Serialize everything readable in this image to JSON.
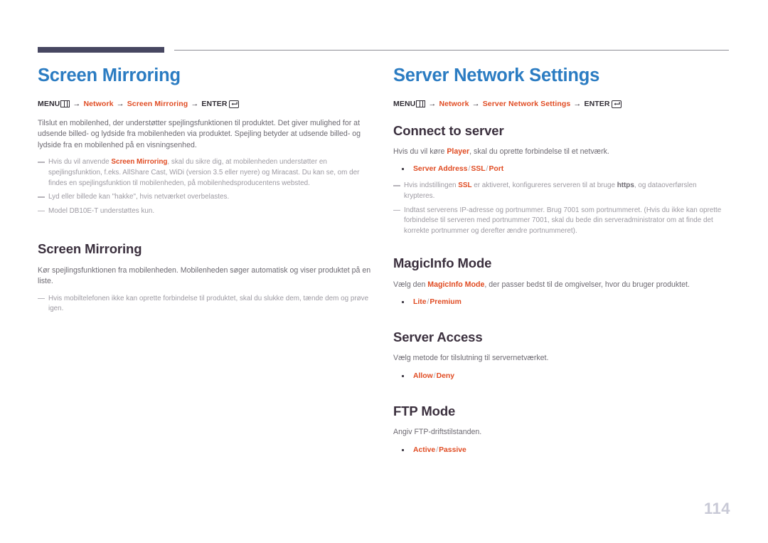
{
  "page": {
    "number": "114",
    "accent_blue": "#2b7cc2",
    "accent_red": "#e04b22",
    "heading_dark": "#3a2f3d",
    "body_gray": "#6d6a72",
    "note_gray": "#9d9aa2",
    "rule_dark": "#474761"
  },
  "left": {
    "title": "Screen Mirroring",
    "menupath": {
      "menu_label": "MENU",
      "menu_icon": "menu-bars-icon",
      "arrow": "→",
      "step1": "Network",
      "step2": "Screen Mirroring",
      "enter_label": "ENTER",
      "enter_icon": "enter-return-icon"
    },
    "intro": {
      "text": "Tilslut en mobilenhed, der understøtter spejlingsfunktionen til produktet. Det giver mulighed for at udsende billed- og lydside fra mobilenheden via produktet. Spejling betyder at udsende billed- og lydside fra en mobilenhed på en visningsenhed."
    },
    "notes": [
      {
        "part1": "Hvis du vil anvende ",
        "strong": "Screen Mirroring",
        "part2": ", skal du sikre dig, at mobilenheden understøtter en spejlingsfunktion, f.eks. AllShare Cast, WiDi (version 3.5 eller nyere) og Miracast. Du kan se, om der findes en spejlingsfunktion til mobilenheden, på mobilenhedsproducentens websted."
      },
      {
        "part1": "Lyd eller billede kan \"hakke\", hvis netværket overbelastes.",
        "strong": "",
        "part2": ""
      },
      {
        "part1": "Model DB10E-T understøttes kun.",
        "strong": "",
        "part2": ""
      }
    ],
    "section": {
      "heading": "Screen Mirroring",
      "body": "Kør spejlingsfunktionen fra mobilenheden. Mobilenheden søger automatisk og viser produktet på en liste.",
      "note": "Hvis mobiltelefonen ikke kan oprette forbindelse til produktet, skal du slukke dem, tænde dem og prøve igen."
    }
  },
  "right": {
    "title": "Server Network Settings",
    "menupath": {
      "menu_label": "MENU",
      "menu_icon": "menu-bars-icon",
      "arrow": "→",
      "step1": "Network",
      "step2": "Server Network Settings",
      "enter_label": "ENTER",
      "enter_icon": "enter-return-icon"
    },
    "connect": {
      "heading": "Connect to server",
      "body_part1": "Hvis du vil køre ",
      "body_strong": "Player",
      "body_part2": ", skal du oprette forbindelse til et netværk.",
      "option": {
        "a": "Server Address",
        "b": "SSL",
        "c": "Port",
        "sep": "/"
      },
      "note1_part1": "Hvis indstillingen ",
      "note1_strong1": "SSL",
      "note1_part2": " er aktiveret, konfigureres serveren til at bruge ",
      "note1_strong2": "https",
      "note1_part3": ", og dataoverførslen krypteres.",
      "note2": "Indtast serverens IP-adresse og portnummer. Brug 7001 som portnummeret. (Hvis du ikke kan oprette forbindelse til serveren med portnummer 7001, skal du bede din serveradministrator om at finde det korrekte portnummer og derefter ændre portnummeret)."
    },
    "magicinfo": {
      "heading": "MagicInfo Mode",
      "body_part1": "Vælg den ",
      "body_strong": "MagicInfo Mode",
      "body_part2": ", der passer bedst til de omgivelser, hvor du bruger produktet.",
      "option": {
        "a": "Lite",
        "b": "Premium",
        "sep": "/"
      }
    },
    "server_access": {
      "heading": "Server Access",
      "body": "Vælg metode for tilslutning til servernetværket.",
      "option": {
        "a": "Allow",
        "b": "Deny",
        "sep": "/"
      }
    },
    "ftp": {
      "heading": "FTP Mode",
      "body": "Angiv FTP-driftstilstanden.",
      "option": {
        "a": "Active",
        "b": "Passive",
        "sep": "/"
      }
    }
  }
}
